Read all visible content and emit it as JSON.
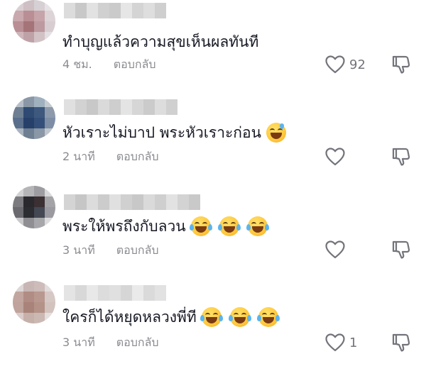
{
  "comments": [
    {
      "text": "ทำบุญแล้วความสุขเห็นผลทันที",
      "time": "4 ชม.",
      "reply": "ตอบกลับ",
      "likes": "92",
      "emojis": []
    },
    {
      "text": "หัวเราะไม่บาป พระหัวเราะก่อน",
      "time": "2 นาที",
      "reply": "ตอบกลับ",
      "likes": "",
      "emojis": [
        "grinning-sweat-emoji"
      ]
    },
    {
      "text": "พระให้พรถึงกับลวน",
      "time": "3 นาที",
      "reply": "ตอบกลับ",
      "likes": "",
      "emojis": [
        "tears-of-joy-emoji",
        "tears-of-joy-emoji",
        "tears-of-joy-emoji"
      ]
    },
    {
      "text": "ใครก็ได้หยุดหลวงพี่ที",
      "time": "3 นาที",
      "reply": "ตอบกลับ",
      "likes": "1",
      "emojis": [
        "tears-of-joy-emoji",
        "tears-of-joy-emoji",
        "tears-of-joy-emoji"
      ]
    }
  ],
  "icons": {
    "like": "heart-outline-icon",
    "dislike": "thumbs-down-outline-icon"
  },
  "colors": {
    "text": "#161823",
    "secondary": "#8a8b91",
    "icon": "#73747b"
  }
}
